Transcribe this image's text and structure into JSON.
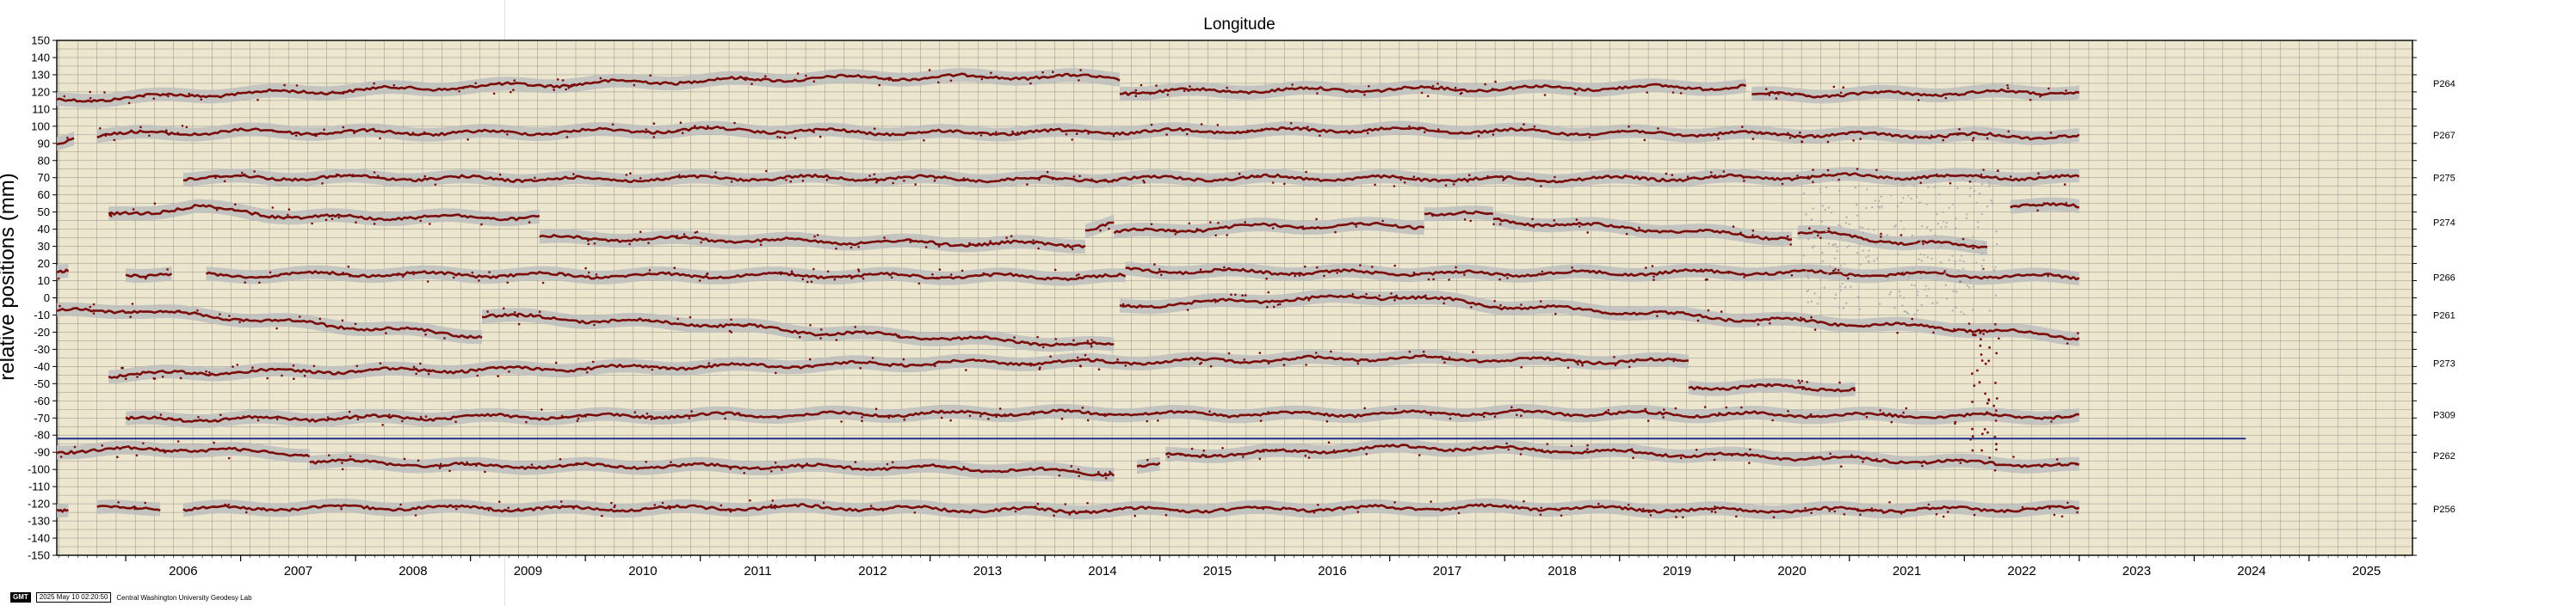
{
  "chart_data": {
    "type": "scatter",
    "title": "Longitude",
    "ylabel": "relative positions (mm)",
    "ylim": [
      -150,
      150
    ],
    "y_ticks": [
      150,
      140,
      130,
      120,
      110,
      100,
      90,
      80,
      70,
      60,
      50,
      40,
      30,
      20,
      10,
      0,
      -10,
      -20,
      -30,
      -40,
      -50,
      -60,
      -70,
      -80,
      -90,
      -100,
      -110,
      -120,
      -130,
      -140,
      -150
    ],
    "xlim": [
      2005.4,
      2025.9
    ],
    "x_ticks": [
      "2006",
      "2007",
      "2008",
      "2009",
      "2010",
      "2011",
      "2012",
      "2013",
      "2014",
      "2015",
      "2016",
      "2017",
      "2018",
      "2019",
      "2020",
      "2021",
      "2022",
      "2023",
      "2024",
      "2025"
    ],
    "grid": true,
    "background_color": "#ece6cf",
    "point_color": "#7a0c0c",
    "error_color": "#bdbdbd",
    "reference_line": {
      "y": -82,
      "x_end": 2024.45,
      "color": "#1f2f8a"
    },
    "series": [
      {
        "name": "P264",
        "label_y": 125,
        "segments": [
          {
            "x": [
              2005.4,
              2006.5,
              2008.0,
              2010.0,
              2012.0,
              2014.0,
              2014.65
            ],
            "y": [
              115,
              118,
              121,
              125,
              128,
              129,
              128
            ]
          },
          {
            "x": [
              2014.65,
              2016.0,
              2018.0,
              2020.1
            ],
            "y": [
              120,
              121,
              122,
              123
            ]
          },
          {
            "x": [
              2020.15,
              2021.5,
              2023.0
            ],
            "y": [
              118,
              119,
              120
            ]
          }
        ]
      },
      {
        "name": "P267",
        "label_y": 95,
        "segments": [
          {
            "x": [
              2005.4,
              2005.55
            ],
            "y": [
              90,
              94
            ]
          },
          {
            "x": [
              2005.75,
              2007.0,
              2009.0,
              2011.0,
              2013.0,
              2015.0,
              2017.0,
              2019.0,
              2021.0,
              2023.0
            ],
            "y": [
              95,
              97,
              96,
              98,
              96,
              97,
              98,
              96,
              95,
              94
            ]
          }
        ]
      },
      {
        "name": "P275",
        "label_y": 70,
        "segments": [
          {
            "x": [
              2006.5,
              2008.0,
              2010.0,
              2012.0,
              2014.0,
              2016.0,
              2018.0,
              2020.0,
              2021.0,
              2023.0
            ],
            "y": [
              70,
              70,
              69,
              70,
              69,
              70,
              69,
              70,
              71,
              70
            ]
          }
        ]
      },
      {
        "name": "P274",
        "label_y": 44,
        "segments": [
          {
            "x": [
              2005.85,
              2006.6,
              2007.5,
              2009.6
            ],
            "y": [
              48,
              53,
              47,
              47
            ]
          },
          {
            "x": [
              2009.6,
              2011.0,
              2013.0,
              2014.35
            ],
            "y": [
              35,
              34,
              32,
              31
            ]
          },
          {
            "x": [
              2014.35,
              2014.6
            ],
            "y": [
              40,
              44
            ]
          },
          {
            "x": [
              2014.6,
              2016.0,
              2017.3
            ],
            "y": [
              38,
              42,
              42
            ]
          },
          {
            "x": [
              2017.3,
              2017.9
            ],
            "y": [
              50,
              48
            ]
          },
          {
            "x": [
              2017.9,
              2019.0,
              2020.5
            ],
            "y": [
              45,
              41,
              35
            ]
          },
          {
            "x": [
              2020.55,
              2021.0,
              2021.5,
              2022.2
            ],
            "y": [
              38,
              36,
              32,
              30
            ]
          },
          {
            "x": [
              2022.4,
              2023.0
            ],
            "y": [
              54,
              53
            ]
          }
        ]
      },
      {
        "name": "P266",
        "label_y": 12,
        "segments": [
          {
            "x": [
              2005.4,
              2005.5
            ],
            "y": [
              15,
              15
            ]
          },
          {
            "x": [
              2006.0,
              2006.4
            ],
            "y": [
              14,
              14
            ]
          },
          {
            "x": [
              2006.7,
              2008.0,
              2010.0,
              2012.0,
              2014.7
            ],
            "y": [
              13,
              14,
              13,
              13,
              12
            ]
          },
          {
            "x": [
              2014.7,
              2016.0,
              2018.0,
              2020.0,
              2021.0,
              2022.0,
              2023.0
            ],
            "y": [
              16,
              15,
              14,
              15,
              14,
              13,
              12
            ]
          }
        ]
      },
      {
        "name": "P261",
        "label_y": -10,
        "segments": [
          {
            "x": [
              2005.4,
              2006.0,
              2007.0,
              2008.0,
              2009.1
            ],
            "y": [
              -8,
              -7,
              -12,
              -17,
              -22
            ]
          },
          {
            "x": [
              2009.1,
              2010.0,
              2011.0,
              2012.0,
              2013.0,
              2014.6
            ],
            "y": [
              -10,
              -13,
              -15,
              -20,
              -23,
              -28
            ]
          },
          {
            "x": [
              2014.65,
              2016.0,
              2017.1,
              2018.0,
              2019.0,
              2020.0,
              2021.0,
              2022.0,
              2023.0
            ],
            "y": [
              -5,
              -1,
              1,
              -5,
              -8,
              -12,
              -15,
              -18,
              -23
            ]
          }
        ]
      },
      {
        "name": "P273",
        "label_y": -38,
        "segments": [
          {
            "x": [
              2005.85,
              2007.0,
              2009.0,
              2011.0,
              2013.0,
              2015.0,
              2017.0,
              2019.0,
              2019.6
            ],
            "y": [
              -45,
              -43,
              -42,
              -40,
              -38,
              -37,
              -35,
              -37,
              -37
            ]
          },
          {
            "x": [
              2019.6,
              2020.5,
              2021.05
            ],
            "y": [
              -52,
              -52,
              -53
            ]
          }
        ]
      },
      {
        "name": "P309",
        "label_y": -68,
        "segments": [
          {
            "x": [
              2006.0,
              2008.0,
              2010.0,
              2012.0,
              2014.0,
              2016.0,
              2018.0,
              2020.0,
              2022.0,
              2023.0
            ],
            "y": [
              -71,
              -70,
              -69,
              -68,
              -67,
              -68,
              -67,
              -68,
              -69,
              -69
            ]
          }
        ]
      },
      {
        "name": "P262",
        "label_y": -92,
        "segments": [
          {
            "x": [
              2005.4,
              2006.5,
              2007.6
            ],
            "y": [
              -89,
              -88,
              -91
            ]
          },
          {
            "x": [
              2007.6,
              2009.0,
              2011.0,
              2013.0,
              2014.6
            ],
            "y": [
              -95,
              -98,
              -98,
              -99,
              -102
            ]
          },
          {
            "x": [
              2014.8,
              2015.0
            ],
            "y": [
              -99,
              -98
            ]
          },
          {
            "x": [
              2015.05,
              2016.0,
              2017.1,
              2018.0,
              2020.0,
              2022.0,
              2023.0
            ],
            "y": [
              -92,
              -90,
              -87,
              -88,
              -92,
              -96,
              -98
            ]
          }
        ]
      },
      {
        "name": "P256",
        "label_y": -123,
        "segments": [
          {
            "x": [
              2005.4,
              2005.5
            ],
            "y": [
              -123,
              -123
            ]
          },
          {
            "x": [
              2005.75,
              2006.3
            ],
            "y": [
              -123,
              -122
            ]
          },
          {
            "x": [
              2006.5,
              2008.0,
              2010.0,
              2012.0,
              2014.0,
              2016.0,
              2018.0,
              2020.0,
              2022.0,
              2023.0
            ],
            "y": [
              -123,
              -122,
              -123,
              -122,
              -124,
              -123,
              -122,
              -124,
              -123,
              -123
            ]
          }
        ]
      }
    ]
  },
  "footer": {
    "logo_text": "GMT",
    "timestamp": "2025 May 10 02:20:50",
    "lab": "Central Washington University Geodesy Lab"
  }
}
